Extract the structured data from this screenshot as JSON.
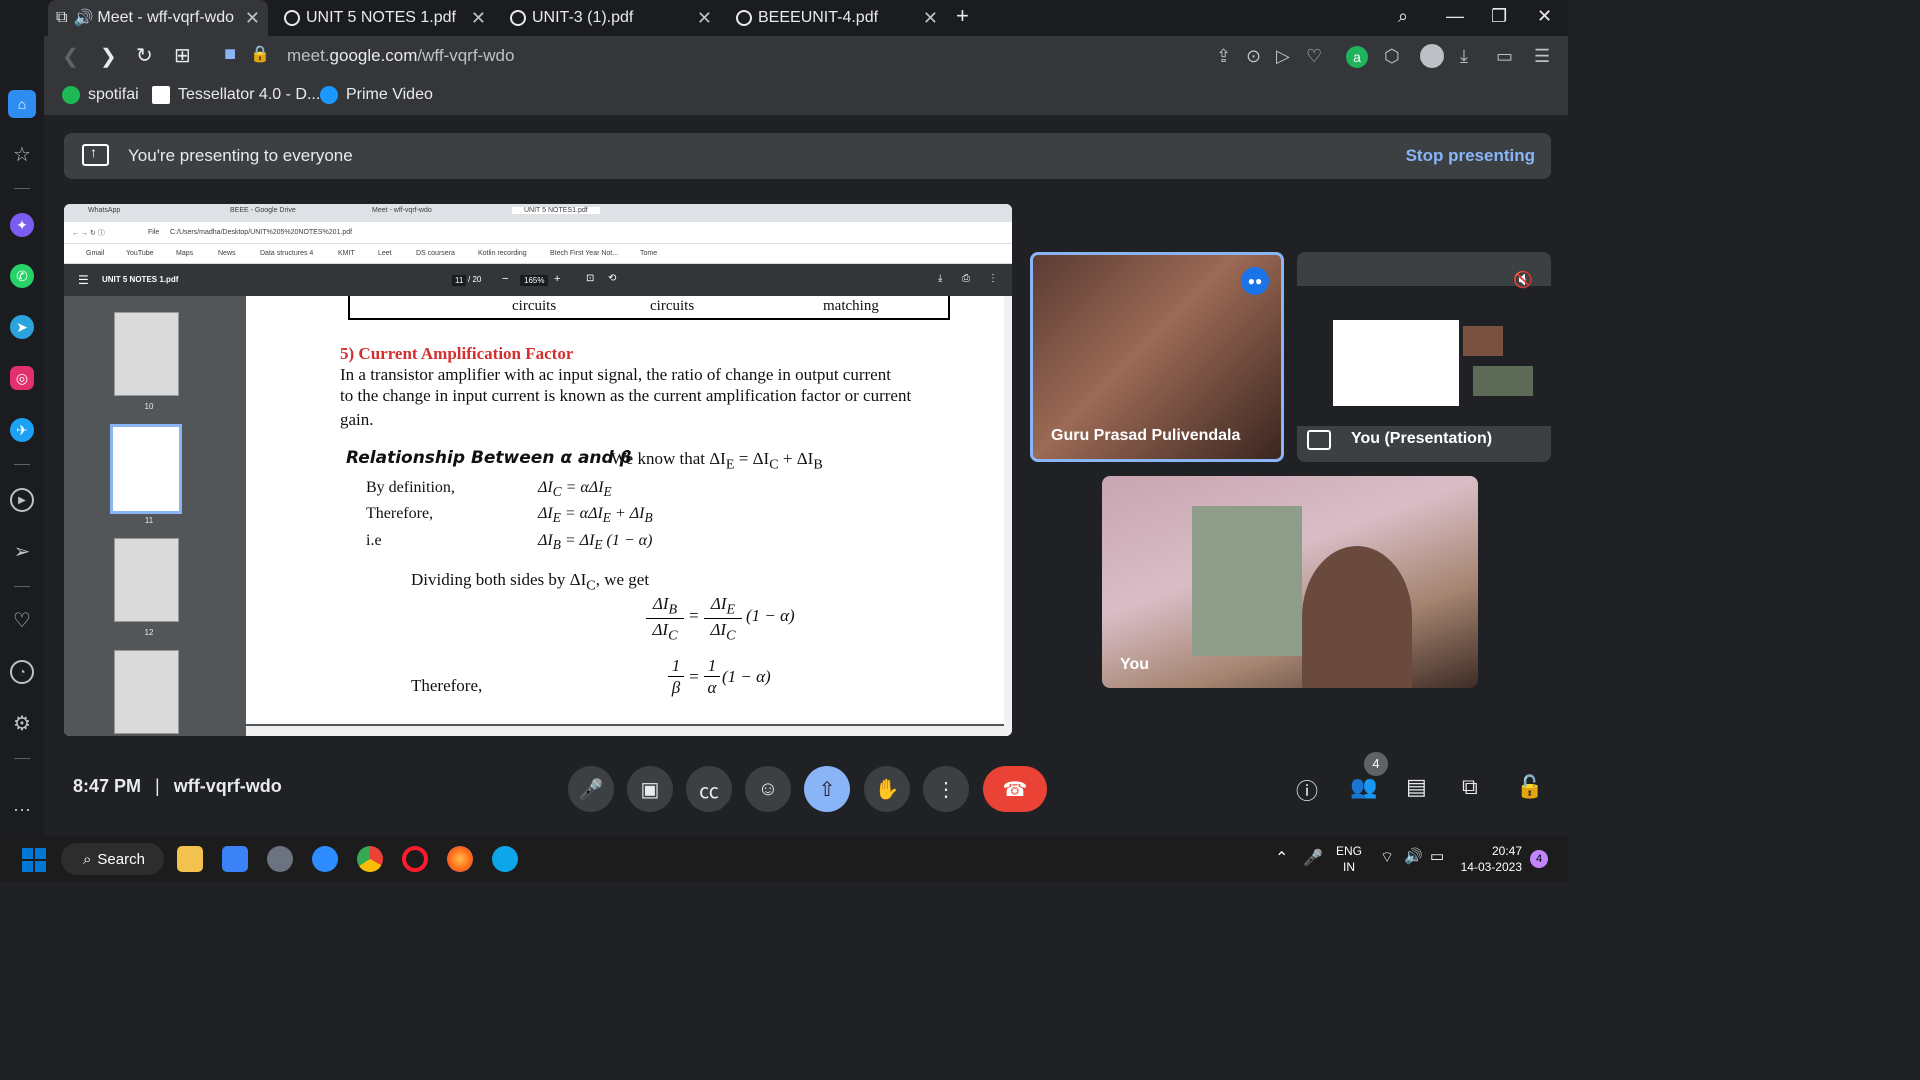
{
  "browser": {
    "tabs": [
      {
        "title": "Meet - wff-vqrf-wdo",
        "active": true
      },
      {
        "title": "UNIT 5 NOTES 1.pdf",
        "active": false
      },
      {
        "title": "UNIT-3 (1).pdf",
        "active": false
      },
      {
        "title": "BEEEUNIT-4.pdf",
        "active": false
      }
    ],
    "url_prefix": "meet.",
    "url_host": "google.com",
    "url_path": "/wff-vqrf-wdo",
    "bookmarks": [
      "spotifai",
      "Tessellator 4.0 - D...",
      "Prime Video"
    ]
  },
  "meet": {
    "banner_text": "You're presenting to everyone",
    "stop_label": "Stop presenting",
    "participants": [
      {
        "name": "Guru Prasad Pulivendala"
      },
      {
        "name": "You (Presentation)"
      },
      {
        "name": "You"
      }
    ],
    "time": "8:47 PM",
    "separator": "|",
    "meeting_code": "wff-vqrf-wdo",
    "people_count": "4",
    "accent_color": "#8ab4f8",
    "end_color": "#ea4335"
  },
  "shared": {
    "inner_tabs": [
      "WhatsApp",
      "BEEE - Google Drive",
      "Meet - wff-vqrf-wdo",
      "UNIT 5 NOTES1.pdf"
    ],
    "inner_url": "C:/Users/madha/Desktop/UNIT%205%20NOTES%201.pdf",
    "file_label": "File",
    "inner_bookmarks": [
      "Gmail",
      "YouTube",
      "Maps",
      "News",
      "Data structures 4",
      "KMIT",
      "Leet",
      "DS coursera",
      "Kotlin recording",
      "Btech First Year Not...",
      "Tome"
    ],
    "pdf_name": "UNIT 5 NOTES 1.pdf",
    "page_current": "11",
    "page_total": "/ 20",
    "zoom": "165%",
    "thumb_numbers": [
      "10",
      "11",
      "12"
    ],
    "table_cells": [
      "circuits",
      "circuits",
      "matching"
    ],
    "heading": "5) Current Amplification Factor",
    "para_line1": "In a transistor amplifier with ac input signal, the ratio of change in output current",
    "para_line2": "to the change in input current is known as the current amplification factor or current",
    "para_line3": "gain.",
    "relationship_title": "Relationship Between α and β",
    "relationship_eq": "We know that ΔI",
    "rel_eq_tail": " = ΔI",
    "rel_eq_tail2": " + ΔI",
    "rows": [
      {
        "label": "By definition,",
        "expr": "ΔI"
      },
      {
        "label": "Therefore,",
        "expr": "ΔI"
      },
      {
        "label": "i.e",
        "expr": "ΔI"
      }
    ],
    "row_rhs": [
      " = αΔI",
      " = αΔI",
      " = ΔI"
    ],
    "row_tail": [
      "",
      " + ΔI",
      " (1 − α)"
    ],
    "dividing": "Dividing both sides by ΔI",
    "dividing_tail": ", we get",
    "frac_rhs": "(1 − α)",
    "therefore2": "Therefore,",
    "one": "1",
    "beta": "β",
    "alpha": "α",
    "equals": "="
  },
  "taskbar": {
    "search_label": "Search",
    "lang1": "ENG",
    "lang2": "IN",
    "clock_time": "20:47",
    "clock_date": "14-03-2023",
    "notif_count": "4"
  }
}
